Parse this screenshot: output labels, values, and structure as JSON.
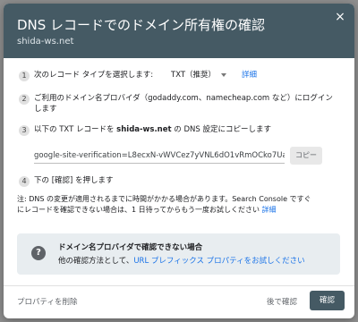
{
  "dialog": {
    "title": "DNS レコードでのドメイン所有権の確認",
    "domain": "shida-ws.net",
    "close_icon": "×"
  },
  "steps": {
    "step1": {
      "number": "1",
      "label": "次のレコード タイプを選択します:",
      "record_type": "TXT（推奨）",
      "details_link": "詳細"
    },
    "step2": {
      "number": "2",
      "line1": "ご利用のドメイン名プロバイダ（godaddy.com、namecheap.com など）にログイン",
      "line2": "します"
    },
    "step3": {
      "number": "3",
      "prefix": "以下の TXT レコードを ",
      "domain": "shida-ws.net",
      "suffix": " の DNS 設定にコピーします",
      "verification_value": "google-site-verification=L8ecxN-vWVCez7yVNL6dO1vRmOCko7Ua",
      "copy_button": "コピー"
    },
    "step4": {
      "number": "4",
      "text": "下の [確認] を押します"
    }
  },
  "note": {
    "line1": "注: DNS の変更が適用されるまでに時間がかかる場合があります。Search Console ですぐ",
    "line2_text": "にレコードを確認できない場合は、1 日待ってからもう一度お試しください",
    "line2_link": "詳細"
  },
  "info_box": {
    "icon": "?",
    "title": "ドメイン名プロバイダで確認できない場合",
    "body_text": "他の確認方法として、",
    "body_link": "URL プレフィックス プロパティをお試しください"
  },
  "footer": {
    "remove_property": "プロパティを削除",
    "later": "後で確認",
    "confirm": "確認"
  },
  "colors": {
    "header_bg": "#455a64",
    "link": "#1a73e8",
    "info_bg": "#e8edf0",
    "confirm_bg": "#455a64"
  }
}
